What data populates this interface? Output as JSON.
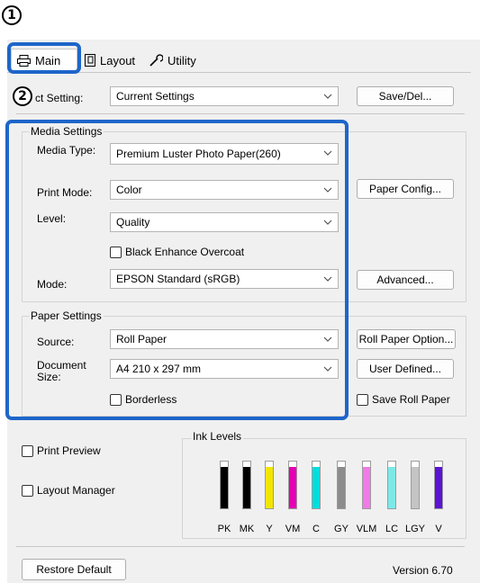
{
  "markers": {
    "one": "1",
    "two": "2"
  },
  "tabs": [
    {
      "label": "Main",
      "icon": "printer-icon"
    },
    {
      "label": "Layout",
      "icon": "page-layout-icon"
    },
    {
      "label": "Utility",
      "icon": "wrench-icon"
    }
  ],
  "select_setting": {
    "label": "ct Setting:",
    "value": "Current Settings",
    "button": "Save/Del..."
  },
  "media_settings": {
    "title": "Media Settings",
    "media_type_label": "Media Type:",
    "media_type_value": "Premium Luster Photo Paper(260)",
    "print_mode_label": "Print Mode:",
    "print_mode_value": "Color",
    "level_label": "Level:",
    "level_value": "Quality",
    "black_enhance_label": "Black Enhance Overcoat",
    "mode_label": "Mode:",
    "mode_value": "EPSON Standard (sRGB)",
    "paper_config_button": "Paper Config...",
    "advanced_button": "Advanced..."
  },
  "paper_settings": {
    "title": "Paper Settings",
    "source_label": "Source:",
    "source_value": "Roll Paper",
    "document_size_label_1": "Document",
    "document_size_label_2": "Size:",
    "document_size_value": "A4 210 x 297 mm",
    "borderless_label": "Borderless",
    "roll_paper_option_button": "Roll Paper Option...",
    "user_defined_button": "User Defined...",
    "save_roll_paper_label": "Save Roll Paper"
  },
  "print_preview_label": "Print Preview",
  "layout_manager_label": "Layout Manager",
  "ink_levels": {
    "title": "Ink Levels",
    "inks": [
      {
        "label": "PK",
        "color": "#000000",
        "level": 0.88
      },
      {
        "label": "MK",
        "color": "#000000",
        "level": 0.88
      },
      {
        "label": "Y",
        "color": "#f2e600",
        "level": 0.88
      },
      {
        "label": "VM",
        "color": "#e600b4",
        "level": 0.88
      },
      {
        "label": "C",
        "color": "#00dede",
        "level": 0.88
      },
      {
        "label": "GY",
        "color": "#8c8c8c",
        "level": 0.88
      },
      {
        "label": "VLM",
        "color": "#f07ae6",
        "level": 0.88
      },
      {
        "label": "LC",
        "color": "#7de8e8",
        "level": 0.88
      },
      {
        "label": "LGY",
        "color": "#c4c4c4",
        "level": 0.88
      },
      {
        "label": "V",
        "color": "#5a14d2",
        "level": 0.88
      }
    ]
  },
  "restore_default_button": "Restore Default",
  "version": "Version 6.70",
  "colors": {
    "highlight": "#1e66c9",
    "dialog_bg": "#f0f0f0"
  }
}
